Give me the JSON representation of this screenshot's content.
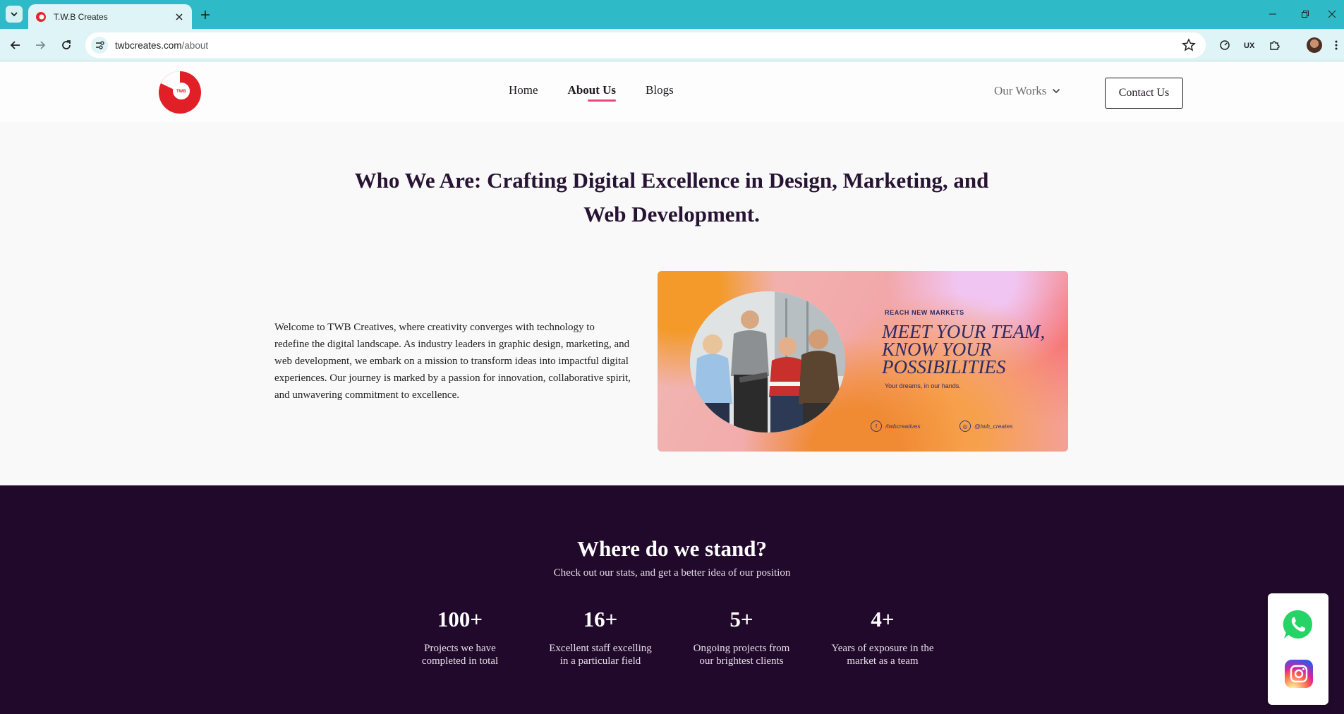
{
  "browser": {
    "tab_title": "T.W.B Creates",
    "url_domain": "twbcreates.com",
    "url_path": "/about"
  },
  "header": {
    "logo_text": "TWB",
    "nav": [
      {
        "label": "Home"
      },
      {
        "label": "About Us",
        "active": true
      },
      {
        "label": "Blogs"
      }
    ],
    "our_works_label": "Our Works",
    "contact_label": "Contact Us",
    "accent_color": "#e64a7a"
  },
  "about": {
    "title_line1": "Who We Are: Crafting Digital Excellence in Design, Marketing, and",
    "title_line2": "Web Development.",
    "body": "Welcome to TWB Creatives, where creativity converges with technology to redefine the digital landscape. As industry leaders in graphic design, marketing, and web development, we embark on a mission to transform ideas into impactful digital experiences. Our journey is marked by a passion for innovation, collaborative spirit, and unwavering commitment to excellence.",
    "banner": {
      "tag": "REACH NEW MARKETS",
      "headline_1": "MEET YOUR TEAM,",
      "headline_2": "KNOW YOUR",
      "headline_3": "POSSIBILITIES",
      "subline": "Your dreams, in our hands.",
      "facebook": "/twbcreatives",
      "instagram": "@twb_creates"
    }
  },
  "stats": {
    "title": "Where do we stand?",
    "subtitle": "Check out our stats, and get a better idea of our position",
    "background_color": "#21092b",
    "items": [
      {
        "value": "100+",
        "line1": "Projects we have",
        "line2": "completed in total"
      },
      {
        "value": "16+",
        "line1": "Excellent staff excelling",
        "line2": "in a particular field"
      },
      {
        "value": "5+",
        "line1": "Ongoing projects from",
        "line2": "our brightest clients"
      },
      {
        "value": "4+",
        "line1": "Years of exposure in the",
        "line2": "market as a team"
      }
    ]
  },
  "floating": {
    "icons": [
      "whatsapp-icon",
      "instagram-icon"
    ]
  }
}
